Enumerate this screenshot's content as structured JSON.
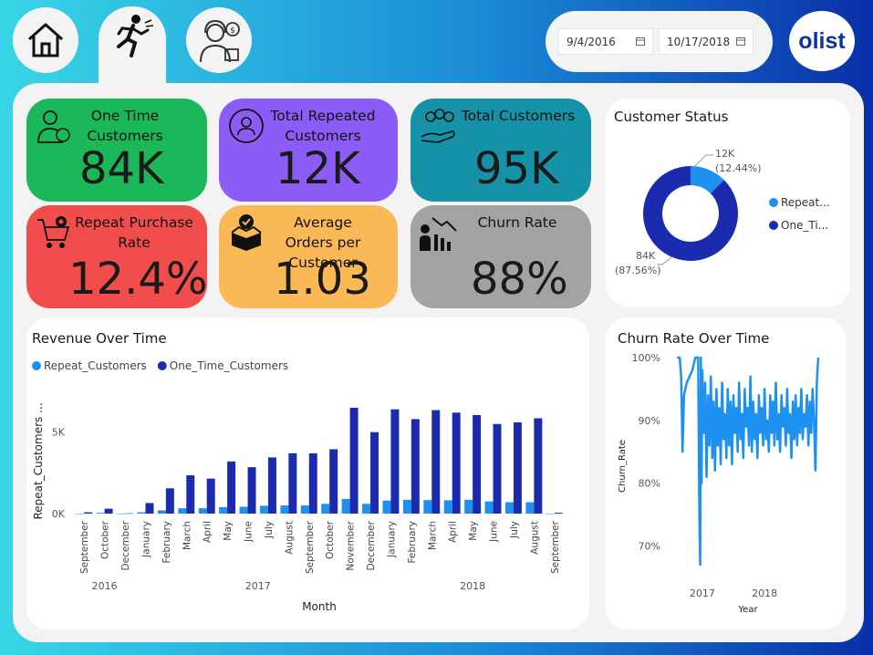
{
  "nav": {
    "items": [
      {
        "name": "home",
        "icon": "home-icon"
      },
      {
        "name": "churn",
        "icon": "running-person-icon",
        "active": true
      },
      {
        "name": "customer-service",
        "icon": "agent-icon"
      }
    ]
  },
  "filters": {
    "start_date": "9/4/2016",
    "end_date": "10/17/2018"
  },
  "brand": {
    "logo_text": "olist"
  },
  "kpis": {
    "one_time": {
      "title": "One Time Customers",
      "value": "84K",
      "color": "#1bb85a"
    },
    "repeated": {
      "title": "Total Repeated Customers",
      "value": "12K",
      "color": "#8b5cf6"
    },
    "total": {
      "title": "Total Customers",
      "value": "95K",
      "color": "#1591a8"
    },
    "repeat_rate": {
      "title": "Repeat Purchase Rate",
      "value": "12.4%",
      "color": "#f24d4d"
    },
    "avg_orders": {
      "title": "Average Orders per Customer",
      "value": "1.03",
      "color": "#fbb955"
    },
    "churn": {
      "title": "Churn Rate",
      "value": "88%",
      "color": "#a3a3a3"
    }
  },
  "colors": {
    "repeat": "#1e90f0",
    "one_time": "#1a2bb0"
  },
  "chart_data": [
    {
      "id": "customer-status",
      "type": "pie",
      "title": "Customer Status",
      "slices": [
        {
          "name": "Repeat...",
          "value": 12,
          "label": "12K",
          "pct": "(12.44%)"
        },
        {
          "name": "One_Ti...",
          "value": 84,
          "label": "84K",
          "pct": "(87.56%)"
        }
      ],
      "legend": "right"
    },
    {
      "id": "revenue-over-time",
      "type": "bar",
      "title": "Revenue Over Time",
      "xlabel": "Month",
      "ylabel": "Repeat_Customers ...",
      "ylim": [
        0,
        7000
      ],
      "yticks": [
        {
          "v": 0,
          "t": "0K"
        },
        {
          "v": 5000,
          "t": "5K"
        }
      ],
      "categories": [
        "September",
        "October",
        "December",
        "January",
        "February",
        "March",
        "April",
        "May",
        "June",
        "July",
        "August",
        "September",
        "October",
        "November",
        "December",
        "January",
        "February",
        "March",
        "April",
        "May",
        "June",
        "July",
        "August",
        "September"
      ],
      "years": [
        {
          "label": "2016",
          "from": 0,
          "to": 2
        },
        {
          "label": "2017",
          "from": 3,
          "to": 14
        },
        {
          "label": "2018",
          "from": 15,
          "to": 23
        }
      ],
      "series": [
        {
          "name": "Repeat_Customers",
          "values": [
            0,
            50,
            0,
            80,
            200,
            330,
            330,
            400,
            420,
            480,
            500,
            500,
            600,
            900,
            600,
            800,
            850,
            830,
            820,
            850,
            750,
            700,
            700,
            0
          ]
        },
        {
          "name": "One_Time_Customers",
          "values": [
            80,
            300,
            20,
            650,
            1550,
            2350,
            2150,
            3200,
            2850,
            3450,
            3700,
            3700,
            3950,
            6500,
            5000,
            6400,
            5800,
            6350,
            6200,
            6050,
            5500,
            5600,
            5850,
            50
          ]
        }
      ],
      "legend": "top-left"
    },
    {
      "id": "churn-rate-over-time",
      "type": "line",
      "title": "Churn Rate Over Time",
      "xlabel": "Year",
      "ylabel": "Churn_Rate",
      "ylim": [
        66,
        100
      ],
      "yticks": [
        {
          "v": 100,
          "t": "100%"
        },
        {
          "v": 90,
          "t": "90%"
        },
        {
          "v": 80,
          "t": "80%"
        },
        {
          "v": 70,
          "t": "70%"
        }
      ],
      "xticks": [
        {
          "v": 0.18,
          "t": "2017"
        },
        {
          "v": 0.62,
          "t": "2018"
        }
      ],
      "x": [
        0.0,
        0.02,
        0.03,
        0.04,
        0.05,
        0.06,
        0.07,
        0.09,
        0.11,
        0.13,
        0.14,
        0.15,
        0.16,
        0.165,
        0.17,
        0.175,
        0.18,
        0.19,
        0.2,
        0.21,
        0.22,
        0.23,
        0.24,
        0.25,
        0.26,
        0.27,
        0.28,
        0.29,
        0.3,
        0.31,
        0.32,
        0.33,
        0.34,
        0.35,
        0.36,
        0.37,
        0.38,
        0.39,
        0.4,
        0.41,
        0.42,
        0.43,
        0.44,
        0.45,
        0.46,
        0.47,
        0.48,
        0.49,
        0.5,
        0.51,
        0.52,
        0.53,
        0.54,
        0.55,
        0.56,
        0.57,
        0.58,
        0.59,
        0.6,
        0.61,
        0.62,
        0.63,
        0.64,
        0.65,
        0.66,
        0.67,
        0.68,
        0.69,
        0.7,
        0.71,
        0.72,
        0.73,
        0.74,
        0.75,
        0.76,
        0.77,
        0.78,
        0.79,
        0.8,
        0.81,
        0.82,
        0.83,
        0.84,
        0.85,
        0.86,
        0.87,
        0.88,
        0.89,
        0.9,
        0.91,
        0.92,
        0.93,
        0.94,
        0.95,
        0.96,
        0.97,
        0.98,
        0.99,
        1.0
      ],
      "y": [
        100,
        100,
        97,
        85,
        94,
        95,
        96,
        97,
        98,
        100,
        100,
        100,
        73,
        67,
        100,
        80,
        98,
        88,
        96,
        81,
        94,
        86,
        97,
        84,
        93,
        82,
        95,
        86,
        92,
        83,
        96,
        87,
        91,
        84,
        95,
        86,
        93,
        83,
        94,
        88,
        92,
        85,
        96,
        87,
        91,
        84,
        95,
        89,
        92,
        86,
        97,
        85,
        93,
        87,
        91,
        84,
        94,
        88,
        92,
        86,
        95,
        87,
        90,
        85,
        94,
        88,
        93,
        86,
        96,
        87,
        91,
        85,
        94,
        89,
        92,
        86,
        95,
        88,
        91,
        84,
        93,
        87,
        94,
        86,
        92,
        88,
        95,
        87,
        91,
        89,
        94,
        86,
        93,
        88,
        95,
        90,
        82,
        96,
        100
      ]
    }
  ]
}
